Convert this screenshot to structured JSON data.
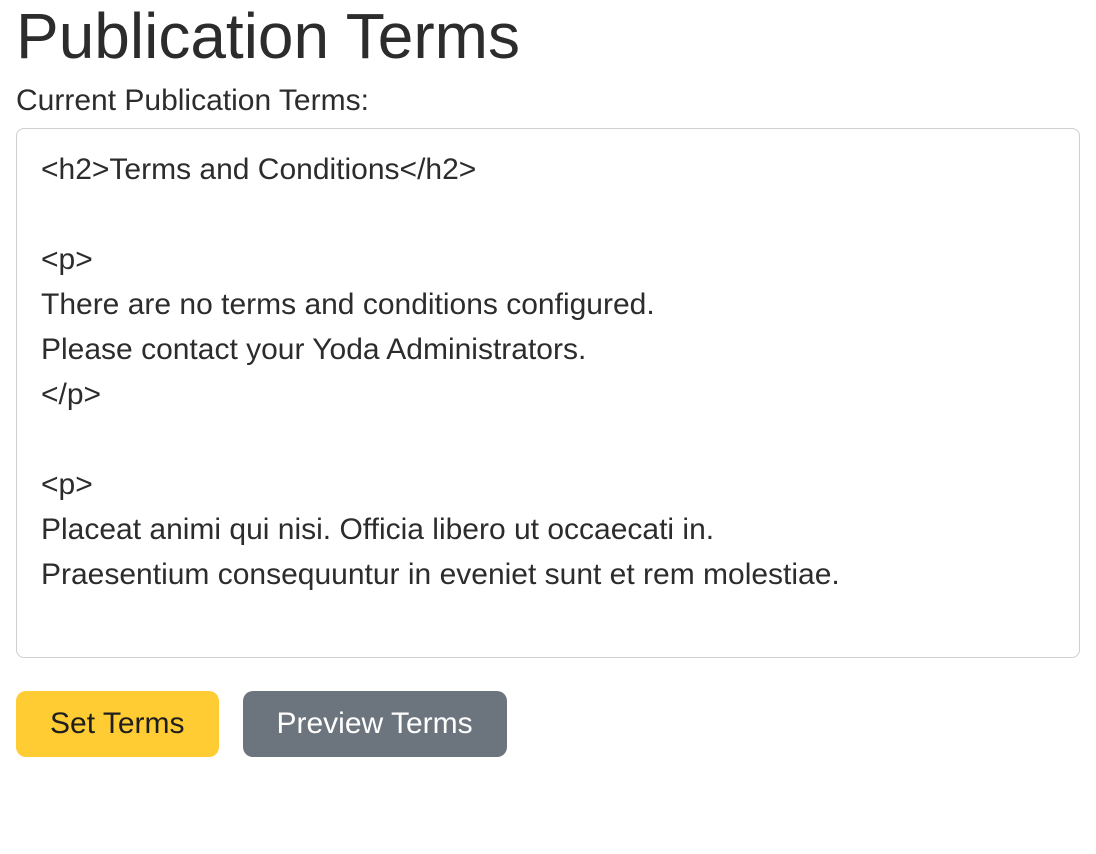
{
  "header": {
    "title": "Publication Terms"
  },
  "form": {
    "label": "Current Publication Terms:",
    "value": "<h2>Terms and Conditions</h2>\n\n<p>\nThere are no terms and conditions configured.\nPlease contact your Yoda Administrators.\n</p>\n\n<p>\nPlaceat animi qui nisi. Officia libero ut occaecati in.\nPraesentium consequuntur in eveniet sunt et rem molestiae."
  },
  "buttons": {
    "set": "Set Terms",
    "preview": "Preview Terms"
  }
}
